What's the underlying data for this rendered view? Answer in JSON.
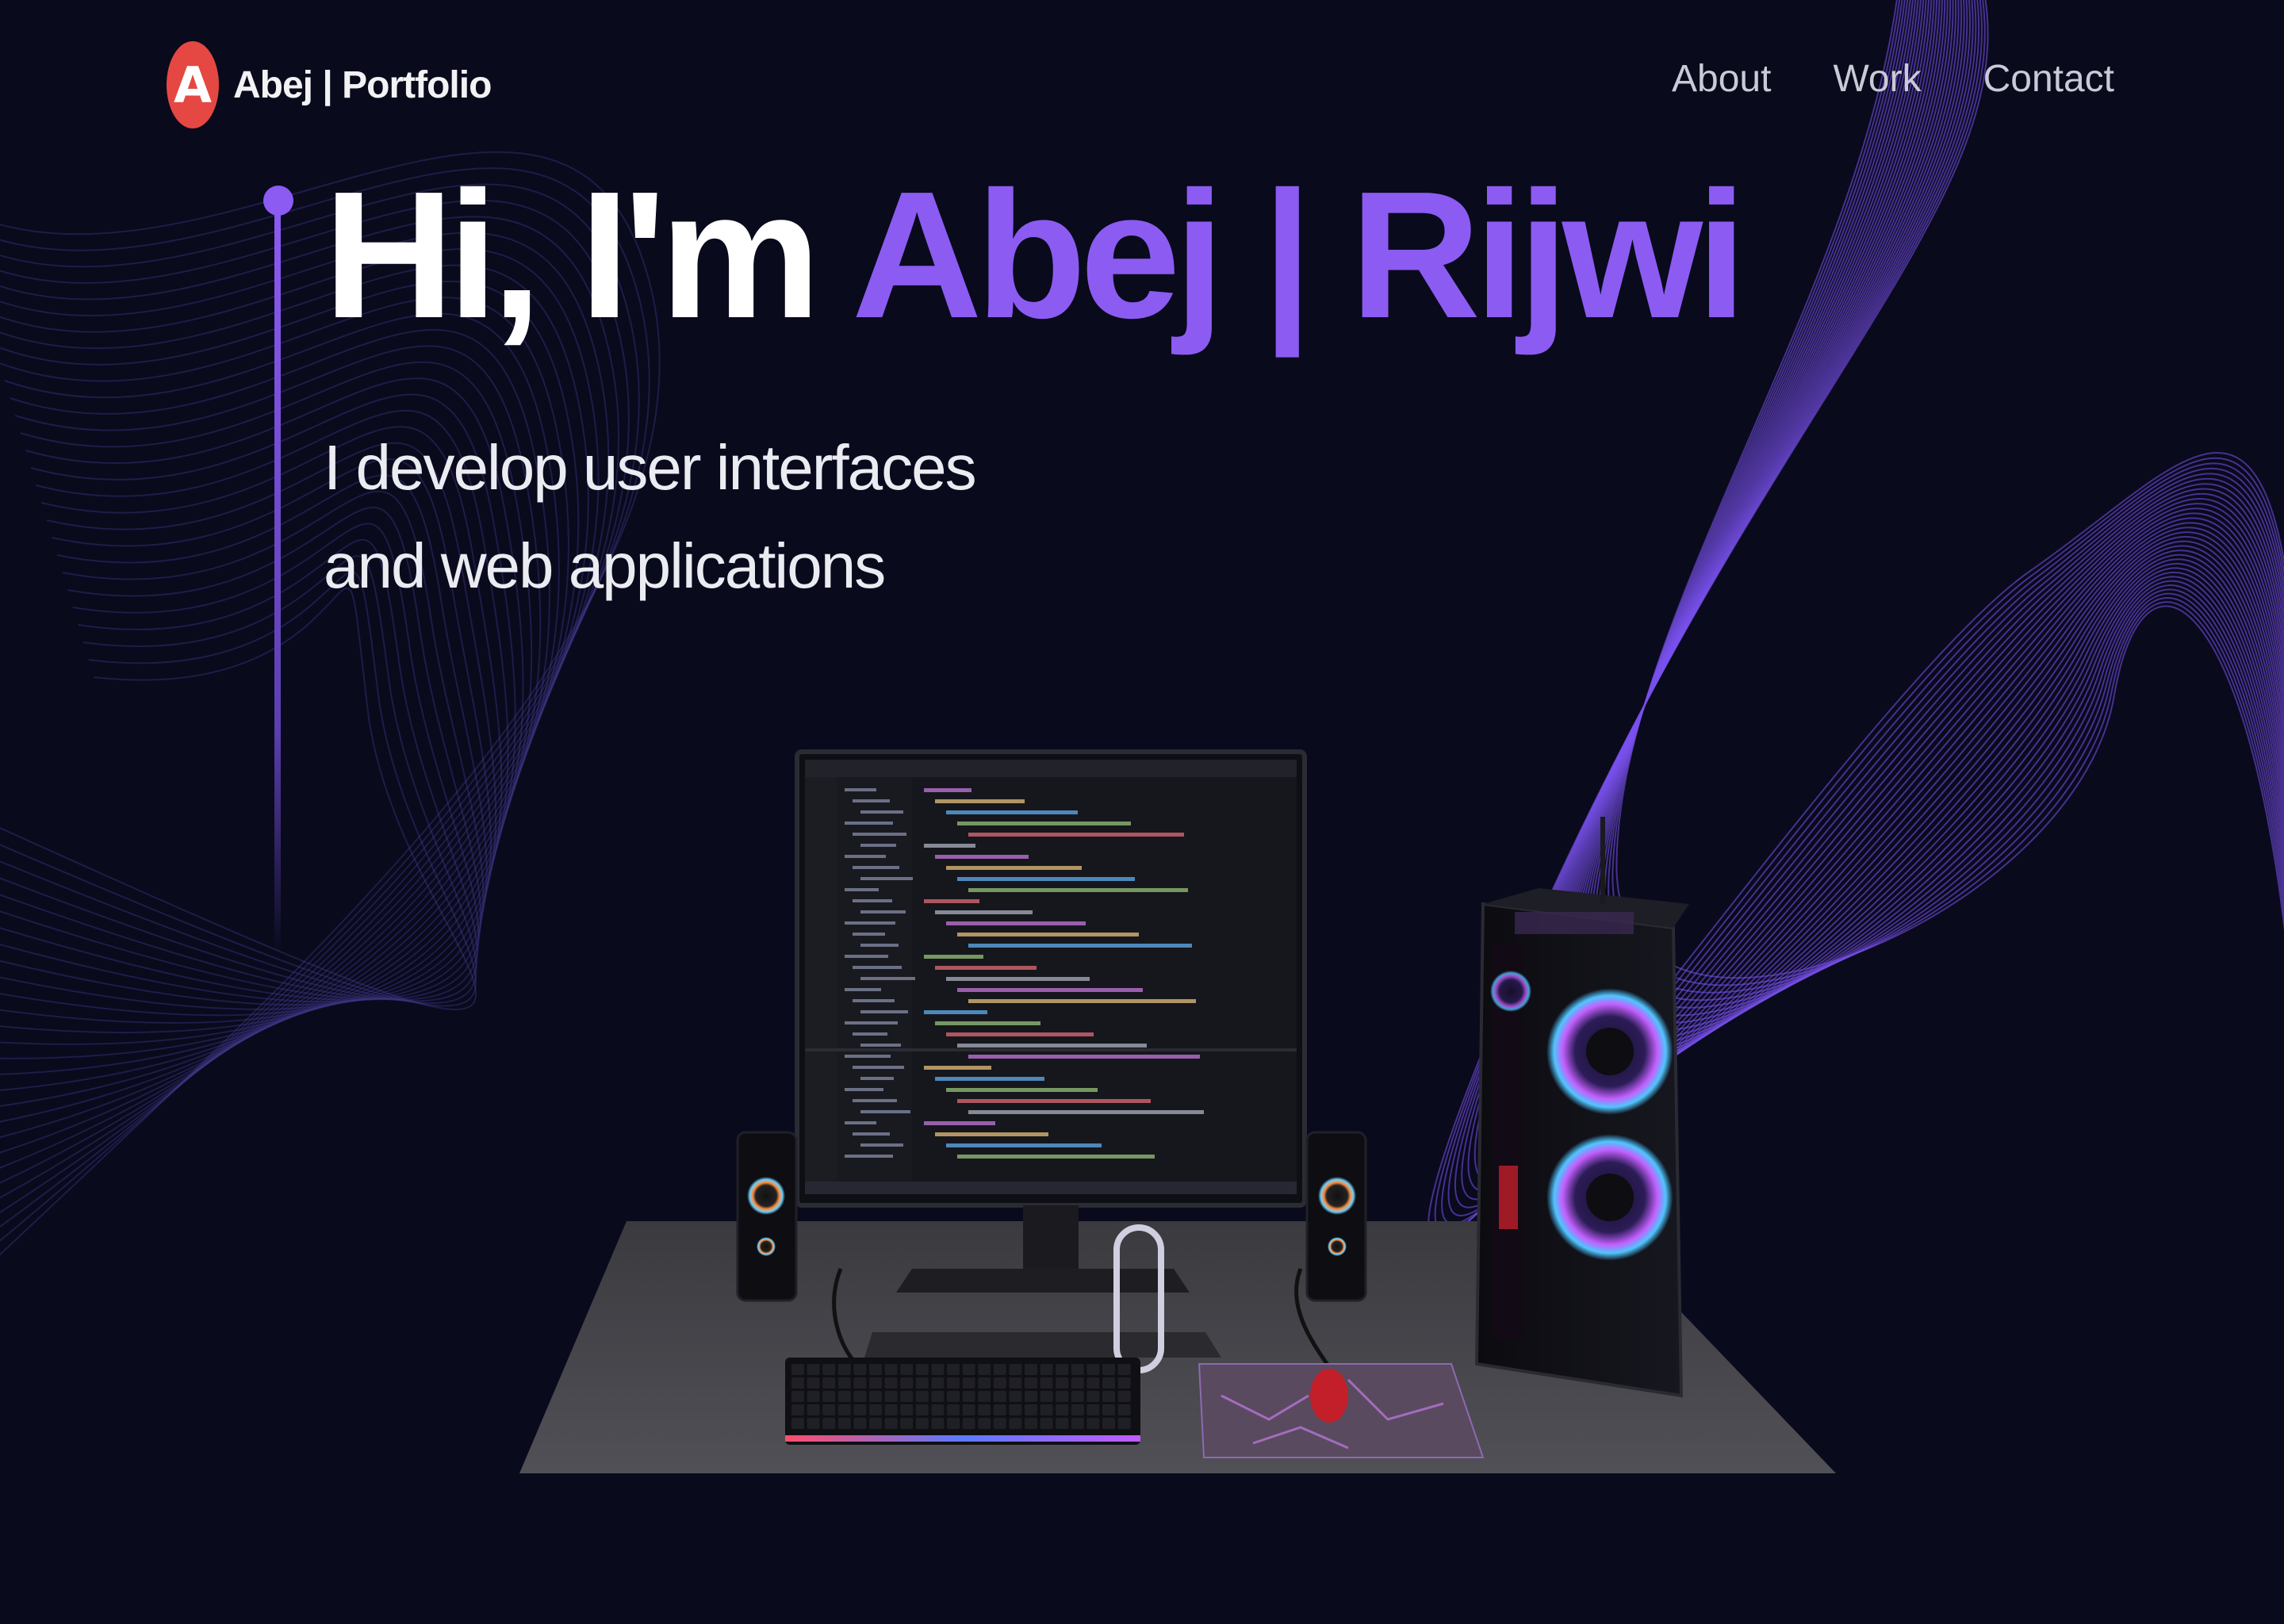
{
  "header": {
    "logo_letter": "A",
    "logo_text": "Abej | Portfolio",
    "nav": [
      {
        "label": "About"
      },
      {
        "label": "Work"
      },
      {
        "label": "Contact"
      }
    ]
  },
  "hero": {
    "greeting": "Hi, I'm ",
    "name": "Abej | Rijwi",
    "subtitle_line1": "I develop user interfaces",
    "subtitle_line2": "and web applications"
  },
  "colors": {
    "background": "#090a1c",
    "accent": "#8c5bf2",
    "logo": "#e54843",
    "text": "#ffffff"
  },
  "icons": [
    "logo-icon"
  ],
  "scene": {
    "description_icon": "desk-setup-illustration"
  }
}
